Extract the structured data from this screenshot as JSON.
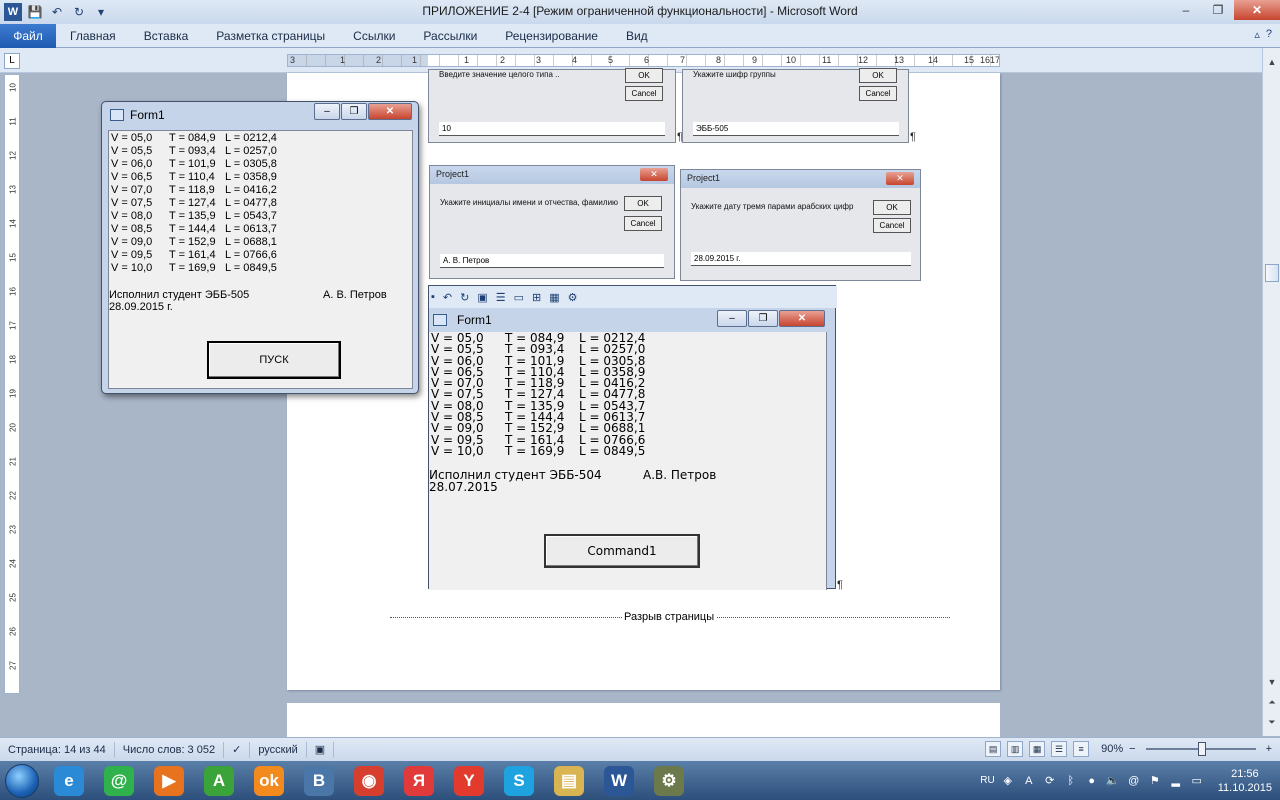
{
  "window": {
    "title": "ПРИЛОЖЕНИЕ 2-4 [Режим ограниченной функциональности]  -  Microsoft Word",
    "help_icon": "?",
    "controls": [
      "–",
      "❐",
      "✕"
    ]
  },
  "qat": {
    "save_icon": "💾",
    "undo_icon": "↶",
    "redo_icon": "↻",
    "dropdown_icon": "▾"
  },
  "ribbon": {
    "file_tab": "Файл",
    "tabs": [
      "Главная",
      "Вставка",
      "Разметка страницы",
      "Ссылки",
      "Рассылки",
      "Рецензирование",
      "Вид"
    ]
  },
  "ruler": {
    "numbers": [
      "3",
      "1",
      "2",
      "1",
      "1",
      "2",
      "3",
      "4",
      "5",
      "6",
      "7",
      "8",
      "9",
      "10",
      "11",
      "12",
      "13",
      "14",
      "15",
      "16",
      "17"
    ],
    "vertical_numbers": [
      "10",
      "11",
      "12",
      "13",
      "14",
      "15",
      "16",
      "17",
      "18",
      "19",
      "20",
      "21",
      "22",
      "23",
      "24",
      "25",
      "26",
      "27"
    ]
  },
  "dialogs": {
    "top_left": {
      "prompt": "Введите значение целого типа ..",
      "ok": "OK",
      "cancel": "Cancel",
      "value": "10"
    },
    "top_right": {
      "prompt": "Укажите шифр группы",
      "ok": "OK",
      "cancel": "Cancel",
      "value": "ЭББ-505"
    },
    "initials": {
      "caption": "Project1",
      "prompt": "Укажите инициалы имени и отчества, фамилию",
      "ok": "OK",
      "cancel": "Cancel",
      "value": "А. В. Петров"
    },
    "date": {
      "caption": "Project1",
      "prompt": "Укажите дату тремя парами арабских цифр",
      "ok": "OK",
      "cancel": "Cancel",
      "value": "28.09.2015 г."
    }
  },
  "form1": {
    "caption": "Form1",
    "rows": [
      [
        "V = 05,0",
        "T = 084,9",
        "L = 0212,4"
      ],
      [
        "V = 05,5",
        "T = 093,4",
        "L = 0257,0"
      ],
      [
        "V = 06,0",
        "T = 101,9",
        "L = 0305,8"
      ],
      [
        "V = 06,5",
        "T = 110,4",
        "L = 0358,9"
      ],
      [
        "V = 07,0",
        "T = 118,9",
        "L = 0416,2"
      ],
      [
        "V = 07,5",
        "T = 127,4",
        "L = 0477,8"
      ],
      [
        "V = 08,0",
        "T = 135,9",
        "L = 0543,7"
      ],
      [
        "V = 08,5",
        "T = 144,4",
        "L = 0613,7"
      ],
      [
        "V = 09,0",
        "T = 152,9",
        "L = 0688,1"
      ],
      [
        "V = 09,5",
        "T = 161,4",
        "L = 0766,6"
      ],
      [
        "V = 10,0",
        "T = 169,9",
        "L = 0849,5"
      ]
    ],
    "author_label": "Исполнил студент  ЭББ-505",
    "author_name": "А. В. Петров",
    "date": "28.09.2015 г.",
    "button": "ПУСК"
  },
  "form2": {
    "caption": "Form1",
    "rows": [
      [
        "V = 05,0",
        "T = 084,9",
        "L = 0212,4"
      ],
      [
        "V = 05,5",
        "T = 093,4",
        "L = 0257,0"
      ],
      [
        "V = 06,0",
        "T = 101,9",
        "L = 0305,8"
      ],
      [
        "V = 06,5",
        "T = 110,4",
        "L = 0358,9"
      ],
      [
        "V = 07,0",
        "T = 118,9",
        "L = 0416,2"
      ],
      [
        "V = 07,5",
        "T = 127,4",
        "L = 0477,8"
      ],
      [
        "V = 08,0",
        "T = 135,9",
        "L = 0543,7"
      ],
      [
        "V = 08,5",
        "T = 144,4",
        "L = 0613,7"
      ],
      [
        "V = 09,0",
        "T = 152,9",
        "L = 0688,1"
      ],
      [
        "V = 09,5",
        "T = 161,4",
        "L = 0766,6"
      ],
      [
        "V = 10,0",
        "T = 169,9",
        "L = 0849,5"
      ]
    ],
    "author_label": "Исполнил студент  ЭББ-504",
    "author_name": "А.В. Петров",
    "date": "28.07.2015",
    "button": "Command1"
  },
  "document": {
    "page_break_label": "Разрыв страницы",
    "pilcrow": "¶"
  },
  "statusbar": {
    "page": "Страница: 14 из 44",
    "words": "Число слов: 3 052",
    "language": "русский",
    "zoom": "90%",
    "zoom_out": "−",
    "zoom_in": "+"
  },
  "taskbar": {
    "apps": [
      {
        "name": "internet-explorer",
        "glyph": "e",
        "color": "#2a8ad6"
      },
      {
        "name": "mail-ru-agent",
        "glyph": "@",
        "color": "#2fb14b"
      },
      {
        "name": "media-player",
        "glyph": "▶",
        "color": "#e8731f"
      },
      {
        "name": "download-manager",
        "glyph": "A",
        "color": "#3aa33a"
      },
      {
        "name": "odnoklassniki",
        "glyph": "ok",
        "color": "#f28a1e"
      },
      {
        "name": "vkontakte",
        "glyph": "B",
        "color": "#4a76a8"
      },
      {
        "name": "chrome",
        "glyph": "◉",
        "color": "#d63f2e"
      },
      {
        "name": "yandex",
        "glyph": "Я",
        "color": "#e03a3a"
      },
      {
        "name": "yandex-browser",
        "glyph": "Y",
        "color": "#e23b2e"
      },
      {
        "name": "skype",
        "glyph": "S",
        "color": "#1fa3e0"
      },
      {
        "name": "explorer",
        "glyph": "▤",
        "color": "#d9b453"
      },
      {
        "name": "word-document",
        "glyph": "W",
        "color": "#2b5797"
      },
      {
        "name": "vb-project",
        "glyph": "⚙",
        "color": "#6c7a4b"
      }
    ],
    "language": "RU",
    "time": "21:56",
    "date": "11.10.2015"
  }
}
